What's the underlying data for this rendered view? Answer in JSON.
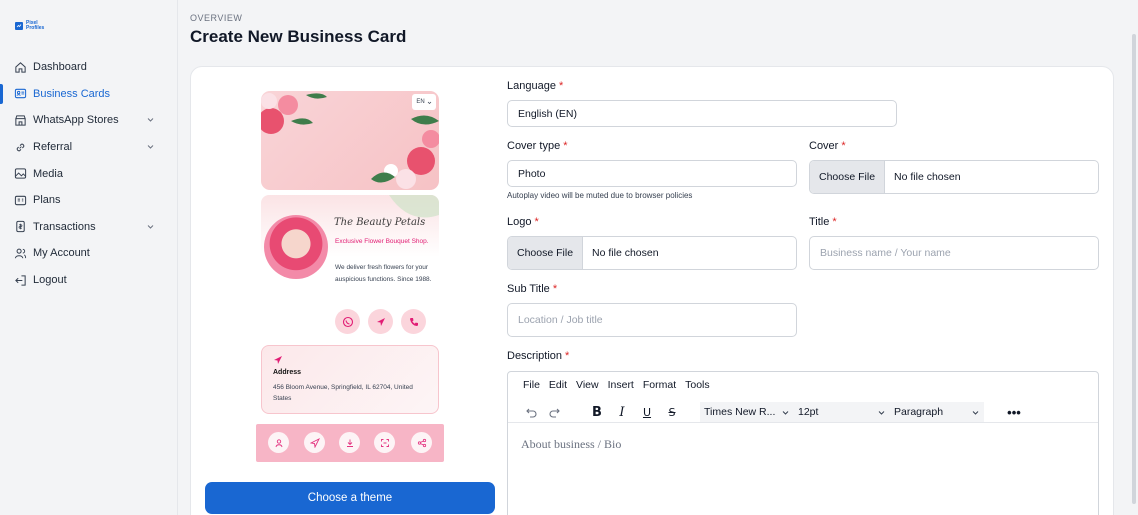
{
  "brand": {
    "logo_text_1": "Pixel",
    "logo_text_2": "Profiles"
  },
  "sidebar": {
    "items": [
      {
        "label": "Dashboard",
        "icon": "home-icon"
      },
      {
        "label": "Business Cards",
        "icon": "id-card-icon",
        "active": true
      },
      {
        "label": "WhatsApp Stores",
        "icon": "store-icon",
        "expandable": true
      },
      {
        "label": "Referral",
        "icon": "link-icon",
        "expandable": true
      },
      {
        "label": "Media",
        "icon": "image-icon"
      },
      {
        "label": "Plans",
        "icon": "id-card-icon"
      },
      {
        "label": "Transactions",
        "icon": "receipt-icon",
        "expandable": true
      },
      {
        "label": "My Account",
        "icon": "users-icon"
      },
      {
        "label": "Logout",
        "icon": "logout-icon"
      }
    ]
  },
  "header": {
    "overline": "OVERVIEW",
    "title": "Create New Business Card"
  },
  "preview": {
    "lang": "EN",
    "brand_name": "The Beauty Petals",
    "tagline": "Exclusive Flower Bouquet Shop.",
    "description": "We deliver fresh flowers for your auspicious functions. Since 1988.",
    "address_title": "Address",
    "address_text": "456 Bloom Avenue, Springfield, IL 62704, United States",
    "theme_button": "Choose a theme"
  },
  "form": {
    "language": {
      "label": "Language",
      "value": "English (EN)"
    },
    "cover_type": {
      "label": "Cover type",
      "value": "Photo",
      "hint": "Autoplay video will be muted due to browser policies"
    },
    "cover": {
      "label": "Cover",
      "button": "Choose File",
      "status": "No file chosen"
    },
    "logo": {
      "label": "Logo",
      "button": "Choose File",
      "status": "No file chosen"
    },
    "title": {
      "label": "Title",
      "placeholder": "Business name / Your name"
    },
    "sub_title": {
      "label": "Sub Title",
      "placeholder": "Location / Job title"
    },
    "description": {
      "label": "Description",
      "menu": [
        "File",
        "Edit",
        "View",
        "Insert",
        "Format",
        "Tools"
      ],
      "font": "Times New R...",
      "size": "12pt",
      "block": "Paragraph",
      "placeholder": "About business / Bio"
    },
    "required_mark": "*"
  },
  "colors": {
    "accent": "#1967d2",
    "required": "#dc2626",
    "pink": "#e11d74"
  }
}
